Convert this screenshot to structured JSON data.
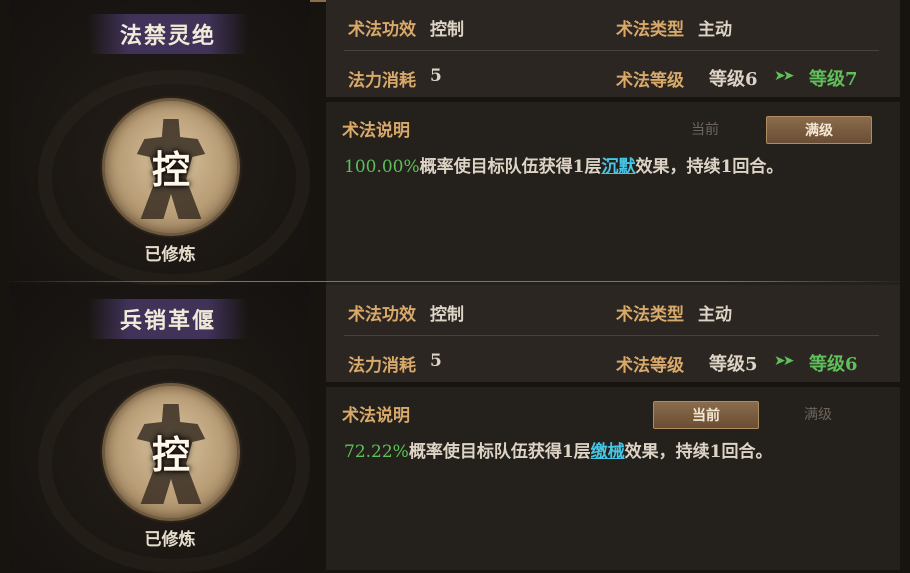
{
  "skills": [
    {
      "name": "法禁灵绝",
      "badge": "控",
      "status": "已修炼",
      "effect_label": "术法功效",
      "effect_value": "控制",
      "type_label": "术法类型",
      "type_value": "主动",
      "cost_label": "法力消耗",
      "cost_value": "5",
      "level_label": "术法等级",
      "level_current": "等级6",
      "level_arrow": "➤➤",
      "level_next": "等级7",
      "desc_label": "术法说明",
      "tab_current": "当前",
      "tab_max": "满级",
      "active_tab": "max",
      "desc_percent": "100.00%",
      "desc_pre": "概率使目标队伍获得1层",
      "desc_keyword": "沉默",
      "desc_post": "效果，持续1回合。"
    },
    {
      "name": "兵销革偃",
      "badge": "控",
      "status": "已修炼",
      "effect_label": "术法功效",
      "effect_value": "控制",
      "type_label": "术法类型",
      "type_value": "主动",
      "cost_label": "法力消耗",
      "cost_value": "5",
      "level_label": "术法等级",
      "level_current": "等级5",
      "level_arrow": "➤➤",
      "level_next": "等级6",
      "desc_label": "术法说明",
      "tab_current": "当前",
      "tab_max": "满级",
      "active_tab": "current",
      "desc_percent": "72.22%",
      "desc_pre": "概率使目标队伍获得1层",
      "desc_keyword": "缴械",
      "desc_post": "效果，持续1回合。"
    }
  ]
}
